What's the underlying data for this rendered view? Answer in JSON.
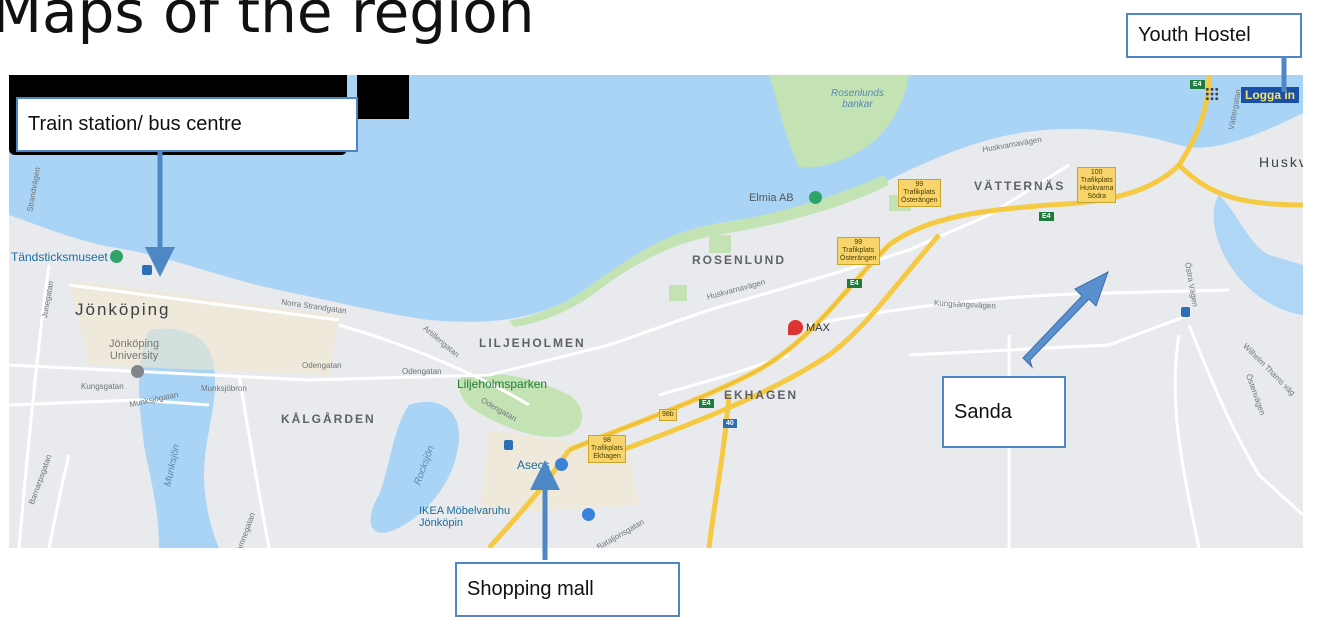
{
  "page_title": "Maps of the region",
  "callouts": {
    "train": "Train station/ bus centre",
    "youth": "Youth Hostel",
    "sanda": "Sanda",
    "shopping": "Shopping mall"
  },
  "map": {
    "login": "Logga in",
    "water": {
      "rosenlunds": "Rosenlunds\nbankar",
      "munksjon": "Munksjön",
      "rocksjon": "Rocksjön"
    },
    "cities": {
      "jonkoping": "Jönköping",
      "huskvarna": "Huskva"
    },
    "districts": {
      "vatternas": "VÄTTERNÄS",
      "rosenlund": "ROSENLUND",
      "liljeholmen": "LILJEHOLMEN",
      "kalgarden": "KÅLGÅRDEN",
      "ekhagen": "EKHAGEN"
    },
    "pois": {
      "tandsticksmuseet": "Tändsticksmuseet",
      "university": "Jönköping\nUniversity",
      "elmia": "Elmia AB",
      "max": "MAX",
      "liljeholmsparken": "Liljeholmsparken",
      "asecs": "Asecs",
      "ikea": "IKEA Möbelvaruhu\nJönköpin"
    },
    "streets": {
      "norra_strandgatan": "Norra Strandgatan",
      "huskvarnavagen1": "Huskvarnavägen",
      "huskvarnavagen2": "Huskvarnavägen",
      "odengatan1": "Odengatan",
      "odengatan2": "Odengatan",
      "odengatan3": "Odengatan",
      "munksjobron": "Munksjöbron",
      "munksjogatan": "Munksjögatan",
      "kungsgatan": "Kungsgatan",
      "barnarpsgatan": "Barnarpsgatan",
      "artillerigatan": "Artillerigatan",
      "kungsangsvagen": "Kungsängsvägen",
      "vattergatan": "Vättergatan",
      "batsjonsgatan": "Bataljonsgatan",
      "junegatan": "Junegatan",
      "strandvagen": "Strandvägen",
      "ostenvagen": "Östenvägen",
      "wilhelm": "Wilhelm Thams väg",
      "drottninggatan": "Östra Vägen",
      "ramnegatan": "Ramnegatan"
    },
    "exits": {
      "e99a": "99\nTrafikplats\nÖsterängen",
      "e99b": "99\nTrafikplats\nÖsterängen",
      "e100": "100\nTrafikplats\nHuskvarna\nSödra",
      "e98": "98\nTrafikplats\nEkhagen",
      "e98b": "98b"
    },
    "road_shields": {
      "e4a": "E4",
      "e4b": "E4",
      "e4c": "E4",
      "e4d": "E4",
      "e4e": "E4",
      "r40": "40"
    }
  },
  "colors": {
    "water": "#a9d4f5",
    "land": "#e8eaed",
    "park": "#c4e3b4",
    "highway": "#f6c943",
    "callout_border": "#4e87c6",
    "arrow": "#5a8fd0"
  }
}
